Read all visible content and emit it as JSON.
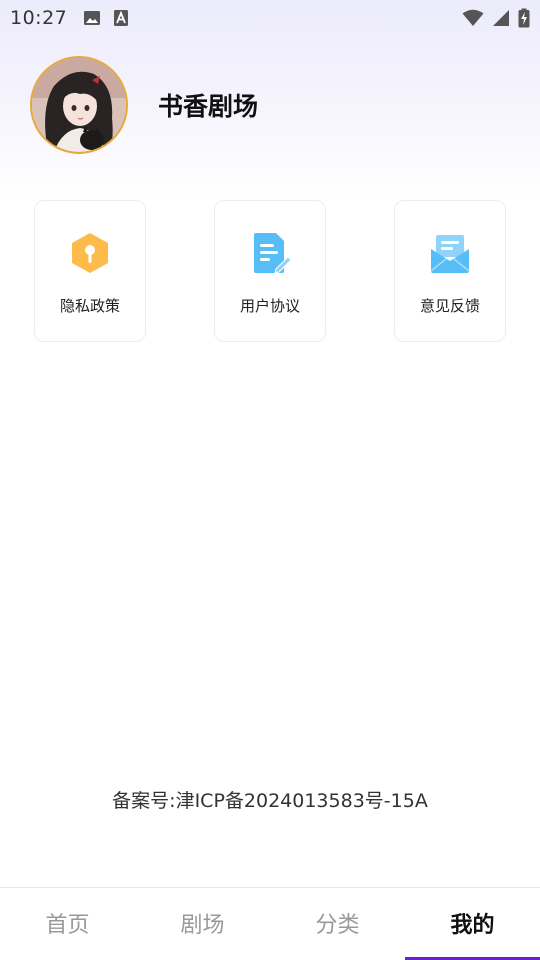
{
  "status_bar": {
    "time": "10:27",
    "left_icons": [
      "image-icon",
      "font-a-icon"
    ],
    "right_icons": [
      "wifi-icon",
      "signal-icon",
      "battery-charging-icon"
    ]
  },
  "profile": {
    "username": "书香剧场",
    "avatar_icon": "avatar-image"
  },
  "menu": {
    "items": [
      {
        "label": "隐私政策",
        "icon": "shield-key-icon",
        "color": "#fdbb4c"
      },
      {
        "label": "用户协议",
        "icon": "document-edit-icon",
        "color": "#57bdf6"
      },
      {
        "label": "意见反馈",
        "icon": "mail-open-icon",
        "color": "#57bdf6"
      }
    ]
  },
  "icp": {
    "text": "备案号:津ICP备2024013583号-15A"
  },
  "bottom_nav": {
    "items": [
      {
        "label": "首页"
      },
      {
        "label": "剧场"
      },
      {
        "label": "分类"
      },
      {
        "label": "我的"
      }
    ],
    "active_index": 3,
    "accent_color": "#6a1fd0"
  }
}
